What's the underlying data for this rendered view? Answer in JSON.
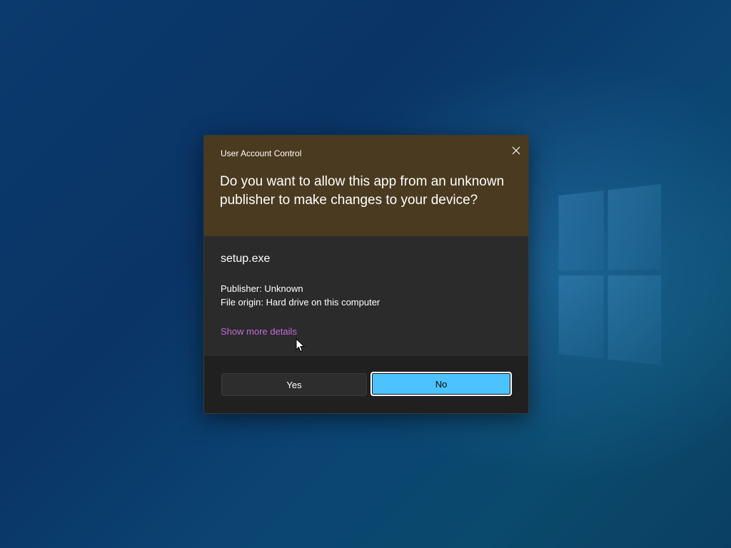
{
  "dialog": {
    "title": "User Account Control",
    "question": "Do you want to allow this app from an unknown publisher to make changes to your device?",
    "app_name": "setup.exe",
    "publisher": "Publisher: Unknown",
    "file_origin": "File origin: Hard drive on this computer",
    "details_link": "Show more details",
    "yes_label": "Yes",
    "no_label": "No"
  },
  "colors": {
    "header_bg": "#4a3a1f",
    "body_bg": "#2b2b2b",
    "footer_bg": "#202020",
    "accent": "#4cc2ff",
    "link": "#c36bd6"
  },
  "icons": {
    "close": "close-icon",
    "cursor": "mouse-pointer-icon",
    "wallpaper_logo": "windows-logo-icon"
  }
}
